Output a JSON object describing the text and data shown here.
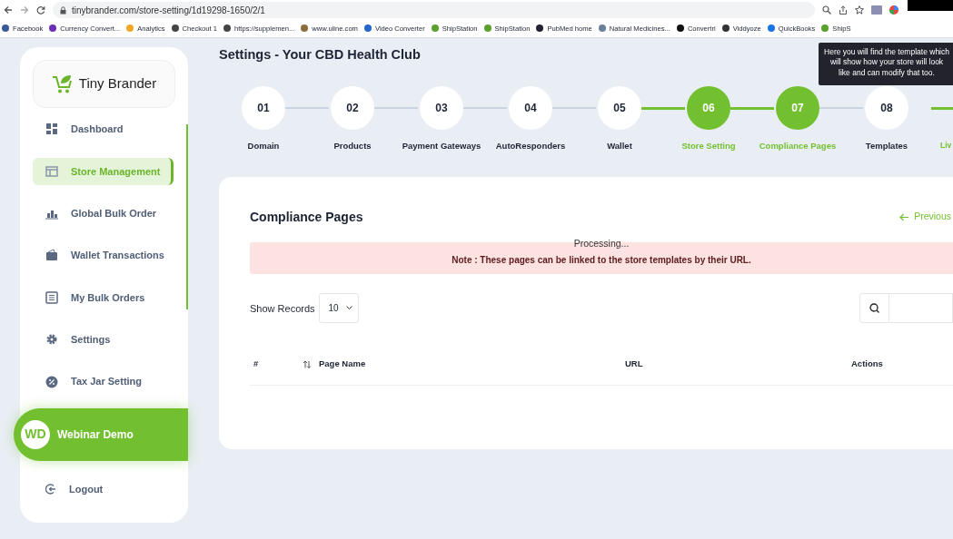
{
  "browser": {
    "url": "tinybrander.com/store-setting/1d19298-1650/2/1",
    "bookmarks": [
      "Facebook",
      "Currency Convert...",
      "Analytics",
      "Checkout 1",
      "https://supplemen...",
      "www.uline.com",
      "Video Converter",
      "ShipStation",
      "ShipStation",
      "PubMed home",
      "Natural Medicines...",
      "Convertri",
      "Viddyoze",
      "QuickBooks",
      "ShipS"
    ]
  },
  "sidebar": {
    "logo": "Tiny Brander",
    "items": [
      {
        "label": "Dashboard",
        "selected": false
      },
      {
        "label": "Store Management",
        "selected": true
      },
      {
        "label": "Global Bulk Order",
        "selected": false
      },
      {
        "label": "Wallet Transactions",
        "selected": false
      },
      {
        "label": "My Bulk Orders",
        "selected": false
      },
      {
        "label": "Settings",
        "selected": false
      },
      {
        "label": "Tax Jar Setting",
        "selected": false
      }
    ],
    "user": {
      "initials": "WD",
      "name": "Webinar Demo"
    },
    "logout": "Logout"
  },
  "page_title": "Settings - Your CBD Health Club",
  "steps": [
    {
      "number": "01",
      "label": "Domain",
      "done": false
    },
    {
      "number": "02",
      "label": "Products",
      "done": false,
      "line_done": false
    },
    {
      "number": "03",
      "label": "Payment Gateways",
      "done": false,
      "line_done": false
    },
    {
      "number": "04",
      "label": "AutoResponders",
      "done": false,
      "line_done": false
    },
    {
      "number": "05",
      "label": "Wallet",
      "done": false,
      "line_done": false
    },
    {
      "number": "06",
      "label": "Store Setting",
      "done": true,
      "line_done": true
    },
    {
      "number": "07",
      "label": "Compliance Pages",
      "done": true,
      "line_done": true
    },
    {
      "number": "08",
      "label": "Templates",
      "done": false,
      "line_done": false
    },
    {
      "label": "Liv",
      "done": true,
      "line_done": true
    }
  ],
  "tooltip": "Here you will find the template which will show how your store will look like and can modify that too.",
  "card": {
    "title": "Compliance Pages",
    "previous": "Previous",
    "processing": "Processing...",
    "note": "Note : These pages can be linked to the store templates by their URL.",
    "show_records": "Show Records",
    "records": "10",
    "columns": [
      {
        "label": "#",
        "sortable": false
      },
      {
        "label": "Page Name",
        "sortable": true
      },
      {
        "label": "URL",
        "sortable": false
      },
      {
        "label": "Actions",
        "sortable": false
      }
    ]
  }
}
